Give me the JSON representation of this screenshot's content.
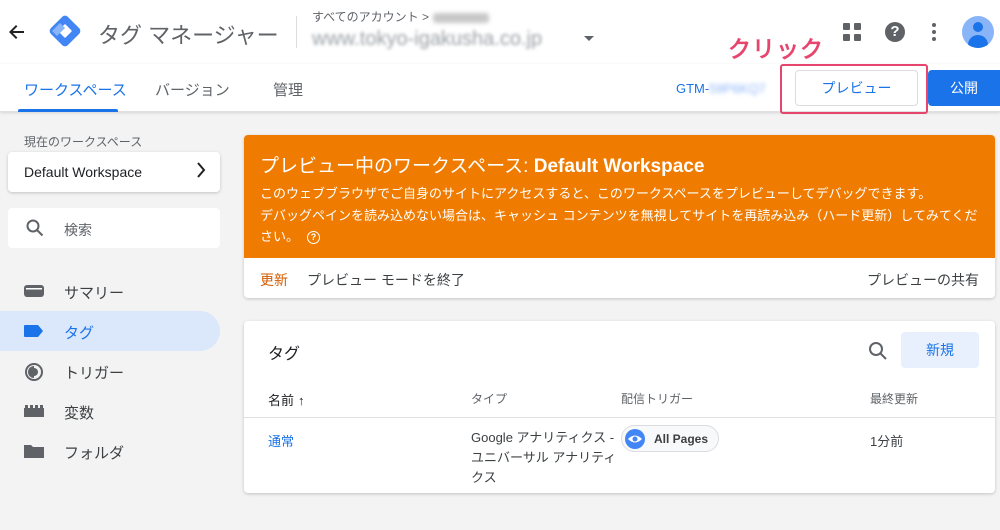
{
  "header": {
    "back_icon": "arrow-left-icon",
    "logo_icon": "tag-manager-logo-icon",
    "app_title": "タグ マネージャー",
    "account_label": "すべてのアカウント >",
    "account_name": "東京医学社",
    "container_name": "www.tokyo-igakusha.co.jp",
    "icons": [
      "apps-grid-icon",
      "help-icon",
      "more-vert-icon",
      "account-avatar-icon"
    ],
    "annotation": "クリック"
  },
  "navbar": {
    "tabs": [
      {
        "label": "ワークスペース",
        "active": true
      },
      {
        "label": "バージョン",
        "active": false
      },
      {
        "label": "管理",
        "active": false
      }
    ],
    "gtm_id_prefix": "GTM-",
    "gtm_id_suffix": "59P6KQ7",
    "preview_label": "プレビュー",
    "publish_label": "公開"
  },
  "sidebar": {
    "workspace_label": "現在のワークスペース",
    "workspace_name": "Default Workspace",
    "search_placeholder": "検索",
    "items": [
      {
        "label": "サマリー",
        "icon": "summary-icon",
        "active": false
      },
      {
        "label": "タグ",
        "icon": "tag-icon",
        "active": true
      },
      {
        "label": "トリガー",
        "icon": "trigger-icon",
        "active": false
      },
      {
        "label": "変数",
        "icon": "variables-icon",
        "active": false
      },
      {
        "label": "フォルダ",
        "icon": "folder-icon",
        "active": false
      }
    ]
  },
  "banner": {
    "title_prefix": "プレビュー中のワークスペース: ",
    "title_workspace": "Default Workspace",
    "line1": "このウェブブラウザでご自身のサイトにアクセスすると、このワークスペースをプレビューしてデバッグできます。",
    "line2": "デバッグペインを読み込めない場合は、キャッシュ コンテンツを無視してサイトを再読み込み（ハード更新）してみてください。",
    "refresh": "更新",
    "exit": "プレビュー モードを終了",
    "share": "プレビューの共有",
    "color": "#ef7c00"
  },
  "tags": {
    "title": "タグ",
    "new_label": "新規",
    "columns": [
      "名前",
      "タイプ",
      "配信トリガー",
      "最終更新"
    ],
    "sort_arrow": "↑",
    "rows": [
      {
        "name": "通常",
        "type": "Google アナリティクス - ユニバーサル アナリティクス",
        "trigger": "All Pages",
        "updated": "1分前"
      }
    ]
  },
  "colors": {
    "accent": "#1a73e8",
    "annotation": "#e6466e",
    "active_nav_bg": "#dbe7fb"
  }
}
